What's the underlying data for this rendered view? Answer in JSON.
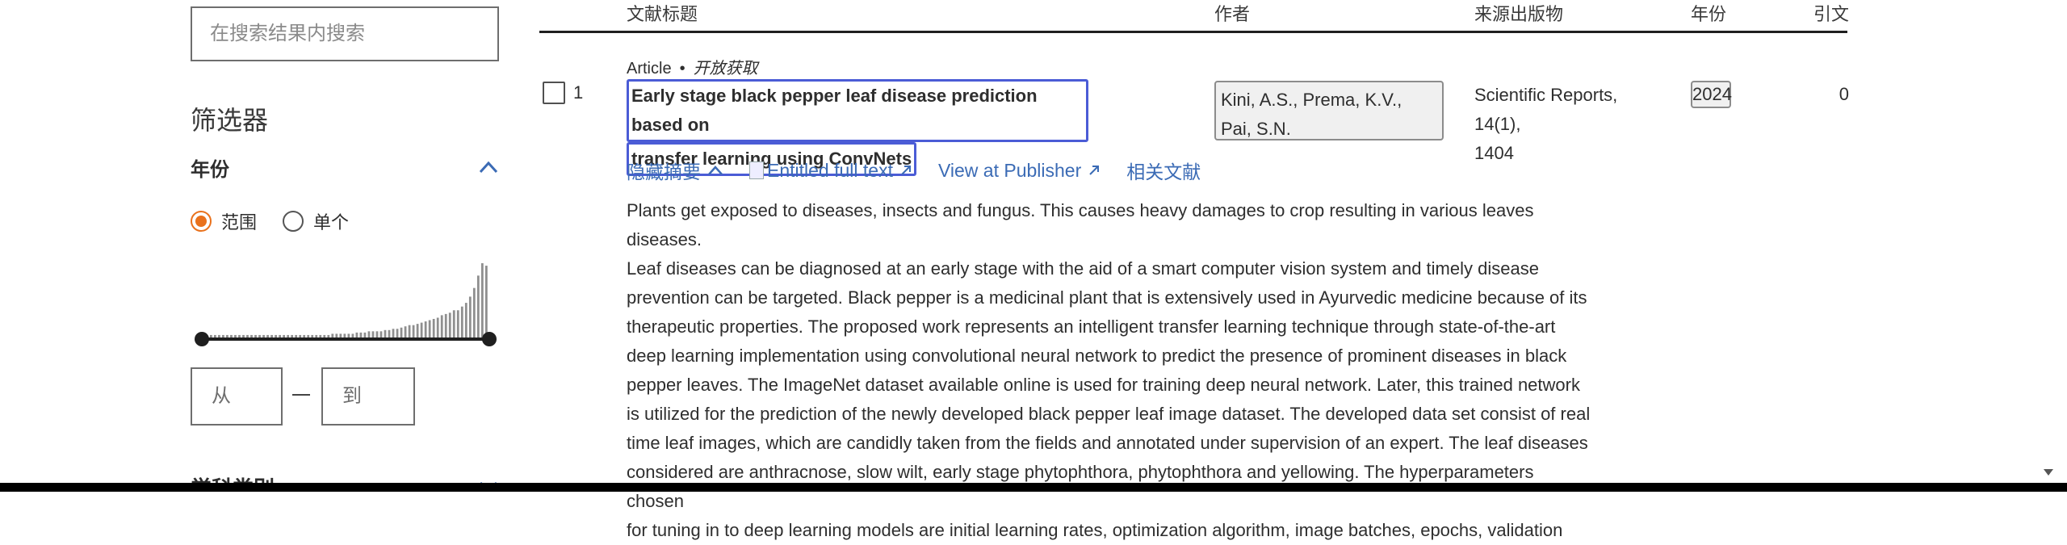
{
  "sidebar": {
    "search_placeholder": "在搜索结果内搜索",
    "filters_title": "筛选器",
    "year_section": {
      "title": "年份",
      "radio_range": "范围",
      "radio_single": "单个",
      "selected": "范围",
      "from_placeholder": "从",
      "to_placeholder": "到",
      "range_slider": {
        "from_fraction": 0,
        "to_fraction": 1
      }
    },
    "next_section_title": "学科类别"
  },
  "table": {
    "headers": {
      "title": "文献标题",
      "authors": "作者",
      "source": "来源出版物",
      "year": "年份",
      "citations": "引文"
    },
    "rows": [
      {
        "index": "1",
        "doc_type": "Article",
        "separator": "•",
        "access": "开放获取",
        "title_line1": "Early stage black pepper leaf disease prediction based on",
        "title_line2": "transfer learning using ConvNets",
        "authors_line1": "Kini, A.S., Prema, K.V.,",
        "authors_line2": "Pai, S.N.",
        "source_line1": "Scientific Reports, 14(1),",
        "source_line2": "1404",
        "year": "2024",
        "citations": "0",
        "actions": {
          "hide_abstract": "隐藏摘要",
          "full_text": "Entitled full text",
          "publisher": "View at Publisher",
          "related": "相关文献"
        },
        "abstract_lines": [
          "Plants get exposed to diseases, insects and fungus. This causes heavy damages to crop resulting in various leaves diseases.",
          "Leaf diseases can be diagnosed at an early stage with the aid of a smart computer vision system and timely disease",
          "prevention can be targeted. Black pepper is a medicinal plant that is extensively used in Ayurvedic medicine because of its",
          "therapeutic properties. The proposed work represents an intelligent transfer learning technique through state-of-the-art",
          "deep learning implementation using convolutional neural network to predict the presence of prominent diseases in black",
          "pepper leaves. The ImageNet dataset available online is used for training deep neural network. Later, this trained network",
          "is utilized for the prediction of the newly developed black pepper leaf image dataset. The developed data set consist of real",
          "time leaf images, which are candidly taken from the fields and annotated under supervision of an expert. The leaf diseases",
          "considered are anthracnose, slow wilt, early stage phytophthora, phytophthora and yellowing. The hyperparameters chosen",
          "for tuning in to deep learning models are initial learning rates, optimization algorithm, image batches, epochs, validation"
        ]
      }
    ]
  },
  "colors": {
    "accent_orange": "#e9711c",
    "link_blue": "#3b6bb5",
    "focus_outline": "#4b5cd6",
    "text": "#2e2e2e"
  },
  "histogram": {
    "counts": [
      2,
      2,
      2,
      2,
      2,
      2,
      2,
      2,
      2,
      2,
      2,
      2,
      2,
      2,
      2,
      2,
      2,
      2,
      2,
      2,
      2,
      2,
      2,
      2,
      2,
      2,
      2,
      2,
      2,
      2,
      3,
      3,
      3,
      3,
      3,
      3,
      4,
      4,
      4,
      5,
      5,
      5,
      5,
      6,
      6,
      7,
      7,
      8,
      9,
      10,
      10,
      11,
      12,
      13,
      14,
      15,
      16,
      18,
      19,
      20,
      22,
      22,
      25,
      28,
      33,
      40,
      50,
      60,
      58
    ]
  }
}
